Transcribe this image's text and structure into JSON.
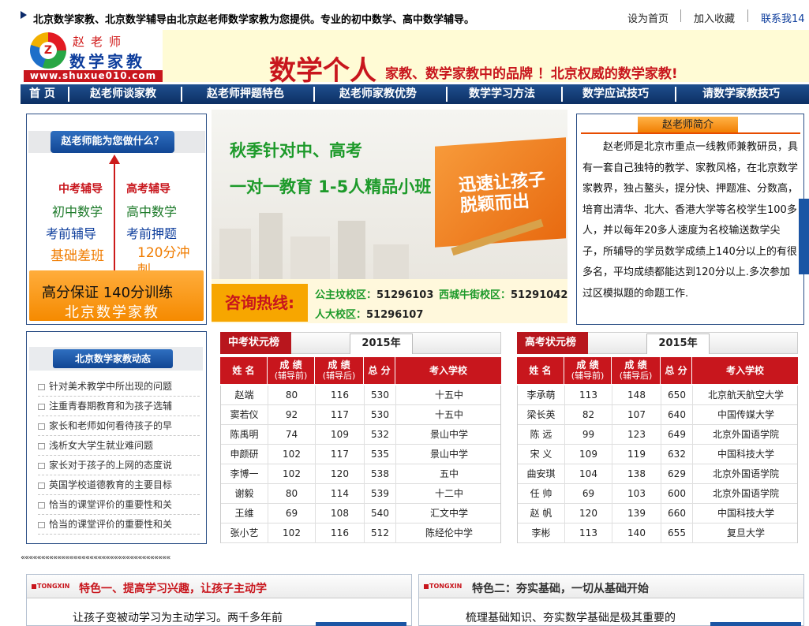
{
  "topbar": {
    "message": "北京数学家教、北京数学辅导由北京赵老师数学家教为您提供。专业的初中数学、高中数学辅导。",
    "links": [
      "设为首页",
      "加入收藏",
      "联系我14"
    ]
  },
  "header": {
    "logo_name": "赵老师",
    "logo_brand": "数学家教",
    "logo_mark": "Z",
    "logo_url": "www.shuxue010.com",
    "slogan_big": "数学个人",
    "slogan_small": "家教、数学家教中的品牌 ！北京权威的数学家教!"
  },
  "nav": [
    "首 页",
    "赵老师谈家教",
    "赵老师押题特色",
    "赵老师家教优势",
    "数学学习方法",
    "数学应试技巧",
    "请数学家教技巧"
  ],
  "left_box": {
    "button": "赵老师能为您做什么？",
    "items": [
      [
        "中考辅导",
        "高考辅导"
      ],
      [
        "初中数学",
        "高中数学"
      ],
      [
        "考前辅导",
        "考前押题"
      ],
      [
        "基础差班",
        "120分冲刺"
      ]
    ],
    "orange_line1": "高分保证  140分训练",
    "orange_line2": "北京数学家教"
  },
  "banner": {
    "line1": "秋季针对中、高考",
    "line2": "一对一教育  1-5人精品小班",
    "book_title": "迅速让孩子脱颖而出",
    "hotline_label": "咨询热线:",
    "campuses": [
      {
        "name": "公主坟校区：",
        "phone": "51296103"
      },
      {
        "name": "西城牛街校区：",
        "phone": "51291042"
      },
      {
        "name": "人大校区：",
        "phone": "51296107"
      }
    ]
  },
  "intro": {
    "tab": "赵老师简介",
    "text": "赵老师是北京市重点一线教师兼教研员，具有一套自己独特的教学、家教风格，在北京数学家教界，独占鳌头，提分快、押题准、分数高，培育出清华、北大、香港大学等名校学生100多人，并以每年20多人速度为名校输送数学尖子，所辅导的学员数学成绩上140分以上的有很多名，平均成绩都能达到120分以上.多次参加过区模拟题的命题工作."
  },
  "news": {
    "button": "北京数学家教动态",
    "items": [
      "针对美术教学中所出现的问题",
      "注重青春期教育和为孩子选辅",
      "家长和老师如何看待孩子的早",
      "浅析女大学生就业难问题",
      "家长对于孩子的上网的态度说",
      "英国学校道德教育的主要目标",
      "恰当的课堂评价的重要性和关",
      "恰当的课堂评价的重要性和关"
    ]
  },
  "zhongkao": {
    "title": "中考状元榜",
    "year": "2015年",
    "headers": [
      "姓 名",
      "成 绩",
      "(辅导前)",
      "成 绩",
      "(辅导后)",
      "总 分",
      "考入学校"
    ],
    "rows": [
      [
        "赵端",
        "80",
        "116",
        "530",
        "十五中"
      ],
      [
        "窦若仪",
        "92",
        "117",
        "530",
        "十五中"
      ],
      [
        "陈禹明",
        "74",
        "109",
        "532",
        "景山中学"
      ],
      [
        "申颜研",
        "102",
        "117",
        "535",
        "景山中学"
      ],
      [
        "李博一",
        "102",
        "120",
        "538",
        "五中"
      ],
      [
        "谢毅",
        "80",
        "114",
        "539",
        "十二中"
      ],
      [
        "王维",
        "69",
        "108",
        "540",
        "汇文中学"
      ],
      [
        "张小艺",
        "102",
        "116",
        "512",
        "陈经伦中学"
      ]
    ]
  },
  "gaokao": {
    "title": "高考状元榜",
    "year": "2015年",
    "headers": [
      "姓 名",
      "成 绩",
      "(辅导前)",
      "成 绩",
      "(辅导后)",
      "总 分",
      "考入学校"
    ],
    "rows": [
      [
        "李承萌",
        "113",
        "148",
        "650",
        "北京航天航空大学"
      ],
      [
        "梁长英",
        "82",
        "107",
        "640",
        "中国传媒大学"
      ],
      [
        "陈 远",
        "99",
        "123",
        "649",
        "北京外国语学院"
      ],
      [
        "宋 义",
        "109",
        "119",
        "632",
        "中国科技大学"
      ],
      [
        "曲安琪",
        "104",
        "138",
        "629",
        "北京外国语学院"
      ],
      [
        "任 帅",
        "69",
        "103",
        "600",
        "北京外国语学院"
      ],
      [
        "赵 帆",
        "120",
        "139",
        "660",
        "中国科技大学"
      ],
      [
        "李彬",
        "113",
        "140",
        "655",
        "复旦大学"
      ]
    ]
  },
  "bottom": {
    "dots": "«««««««««««««««««««««««««««««««««««««",
    "brand": "TONGXIN",
    "feature1_title": "特色一、提高学习兴趣，让孩子主动学",
    "feature1_text": "让孩子变被动学习为主动学习。两千多年前",
    "feature2_title": "特色二：夯实基础，一切从基础开始",
    "feature2_text": "梳理基础知识、夯实数学基础是极其重要的"
  },
  "colors": {
    "brand_red": "#c8161d",
    "nav_blue": "#0c2f63",
    "green": "#1d9a2a",
    "orange": "#f58a00"
  }
}
